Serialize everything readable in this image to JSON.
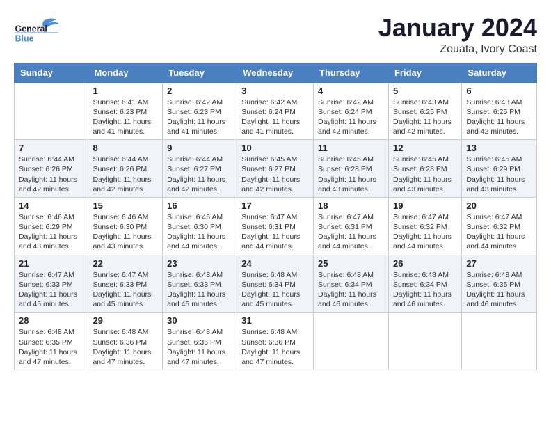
{
  "logo": {
    "line1": "General",
    "line2": "Blue"
  },
  "title": "January 2024",
  "subtitle": "Zouata, Ivory Coast",
  "days_of_week": [
    "Sunday",
    "Monday",
    "Tuesday",
    "Wednesday",
    "Thursday",
    "Friday",
    "Saturday"
  ],
  "weeks": [
    [
      {
        "day": "",
        "info": ""
      },
      {
        "day": "1",
        "info": "Sunrise: 6:41 AM\nSunset: 6:23 PM\nDaylight: 11 hours\nand 41 minutes."
      },
      {
        "day": "2",
        "info": "Sunrise: 6:42 AM\nSunset: 6:23 PM\nDaylight: 11 hours\nand 41 minutes."
      },
      {
        "day": "3",
        "info": "Sunrise: 6:42 AM\nSunset: 6:24 PM\nDaylight: 11 hours\nand 41 minutes."
      },
      {
        "day": "4",
        "info": "Sunrise: 6:42 AM\nSunset: 6:24 PM\nDaylight: 11 hours\nand 42 minutes."
      },
      {
        "day": "5",
        "info": "Sunrise: 6:43 AM\nSunset: 6:25 PM\nDaylight: 11 hours\nand 42 minutes."
      },
      {
        "day": "6",
        "info": "Sunrise: 6:43 AM\nSunset: 6:25 PM\nDaylight: 11 hours\nand 42 minutes."
      }
    ],
    [
      {
        "day": "7",
        "info": "Sunrise: 6:44 AM\nSunset: 6:26 PM\nDaylight: 11 hours\nand 42 minutes."
      },
      {
        "day": "8",
        "info": "Sunrise: 6:44 AM\nSunset: 6:26 PM\nDaylight: 11 hours\nand 42 minutes."
      },
      {
        "day": "9",
        "info": "Sunrise: 6:44 AM\nSunset: 6:27 PM\nDaylight: 11 hours\nand 42 minutes."
      },
      {
        "day": "10",
        "info": "Sunrise: 6:45 AM\nSunset: 6:27 PM\nDaylight: 11 hours\nand 42 minutes."
      },
      {
        "day": "11",
        "info": "Sunrise: 6:45 AM\nSunset: 6:28 PM\nDaylight: 11 hours\nand 43 minutes."
      },
      {
        "day": "12",
        "info": "Sunrise: 6:45 AM\nSunset: 6:28 PM\nDaylight: 11 hours\nand 43 minutes."
      },
      {
        "day": "13",
        "info": "Sunrise: 6:45 AM\nSunset: 6:29 PM\nDaylight: 11 hours\nand 43 minutes."
      }
    ],
    [
      {
        "day": "14",
        "info": "Sunrise: 6:46 AM\nSunset: 6:29 PM\nDaylight: 11 hours\nand 43 minutes."
      },
      {
        "day": "15",
        "info": "Sunrise: 6:46 AM\nSunset: 6:30 PM\nDaylight: 11 hours\nand 43 minutes."
      },
      {
        "day": "16",
        "info": "Sunrise: 6:46 AM\nSunset: 6:30 PM\nDaylight: 11 hours\nand 44 minutes."
      },
      {
        "day": "17",
        "info": "Sunrise: 6:47 AM\nSunset: 6:31 PM\nDaylight: 11 hours\nand 44 minutes."
      },
      {
        "day": "18",
        "info": "Sunrise: 6:47 AM\nSunset: 6:31 PM\nDaylight: 11 hours\nand 44 minutes."
      },
      {
        "day": "19",
        "info": "Sunrise: 6:47 AM\nSunset: 6:32 PM\nDaylight: 11 hours\nand 44 minutes."
      },
      {
        "day": "20",
        "info": "Sunrise: 6:47 AM\nSunset: 6:32 PM\nDaylight: 11 hours\nand 44 minutes."
      }
    ],
    [
      {
        "day": "21",
        "info": "Sunrise: 6:47 AM\nSunset: 6:33 PM\nDaylight: 11 hours\nand 45 minutes."
      },
      {
        "day": "22",
        "info": "Sunrise: 6:47 AM\nSunset: 6:33 PM\nDaylight: 11 hours\nand 45 minutes."
      },
      {
        "day": "23",
        "info": "Sunrise: 6:48 AM\nSunset: 6:33 PM\nDaylight: 11 hours\nand 45 minutes."
      },
      {
        "day": "24",
        "info": "Sunrise: 6:48 AM\nSunset: 6:34 PM\nDaylight: 11 hours\nand 45 minutes."
      },
      {
        "day": "25",
        "info": "Sunrise: 6:48 AM\nSunset: 6:34 PM\nDaylight: 11 hours\nand 46 minutes."
      },
      {
        "day": "26",
        "info": "Sunrise: 6:48 AM\nSunset: 6:34 PM\nDaylight: 11 hours\nand 46 minutes."
      },
      {
        "day": "27",
        "info": "Sunrise: 6:48 AM\nSunset: 6:35 PM\nDaylight: 11 hours\nand 46 minutes."
      }
    ],
    [
      {
        "day": "28",
        "info": "Sunrise: 6:48 AM\nSunset: 6:35 PM\nDaylight: 11 hours\nand 47 minutes."
      },
      {
        "day": "29",
        "info": "Sunrise: 6:48 AM\nSunset: 6:36 PM\nDaylight: 11 hours\nand 47 minutes."
      },
      {
        "day": "30",
        "info": "Sunrise: 6:48 AM\nSunset: 6:36 PM\nDaylight: 11 hours\nand 47 minutes."
      },
      {
        "day": "31",
        "info": "Sunrise: 6:48 AM\nSunset: 6:36 PM\nDaylight: 11 hours\nand 47 minutes."
      },
      {
        "day": "",
        "info": ""
      },
      {
        "day": "",
        "info": ""
      },
      {
        "day": "",
        "info": ""
      }
    ]
  ]
}
